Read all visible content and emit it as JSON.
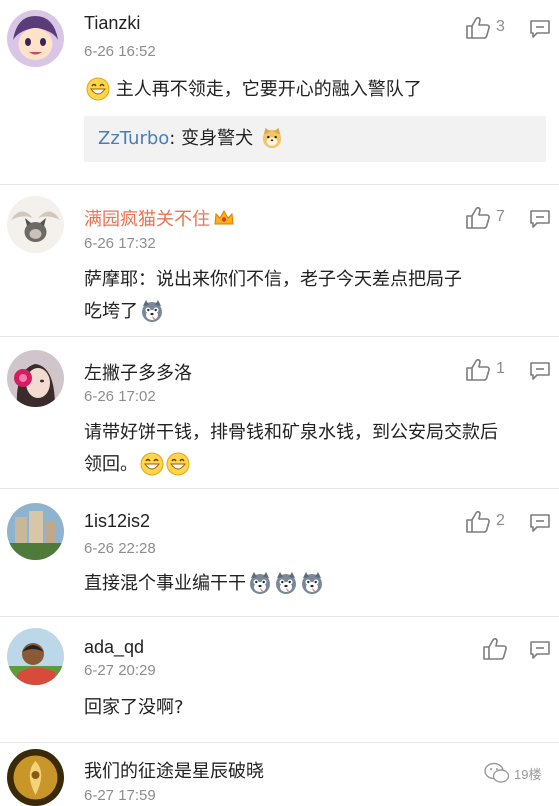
{
  "comments": [
    {
      "username": "Tianzki",
      "time": "6-26 16:52",
      "text": "主人再不领走，它要开心的融入警队了",
      "likes": "3",
      "quote": {
        "user": "ZzTurbo",
        "separator": ": ",
        "text": "变身警犬"
      }
    },
    {
      "username": "满园疯猫关不住",
      "time": "6-26 17:32",
      "text": "萨摩耶：说出来你们不信，老子今天差点把局子吃垮了",
      "likes": "7"
    },
    {
      "username": "左撇子多多洛",
      "time": "6-26 17:02",
      "text": "请带好饼干钱，排骨钱和矿泉水钱，到公安局交款后领回。",
      "likes": "1"
    },
    {
      "username": "1is12is2",
      "time": "6-26 22:28",
      "text": "直接混个事业编干干",
      "likes": "2"
    },
    {
      "username": "ada_qd",
      "time": "6-27 20:29",
      "text": "回家了没啊?",
      "likes": ""
    },
    {
      "username": "我们的征途是星辰破晓",
      "time": "6-27 17:59",
      "text": "",
      "likes": ""
    }
  ],
  "watermark": {
    "label": "19楼",
    "icon": "wechat-icon"
  },
  "colors": {
    "vip_name": "#eb7350",
    "quote_name": "#4a7db8",
    "meta": "#8d8d8d"
  }
}
